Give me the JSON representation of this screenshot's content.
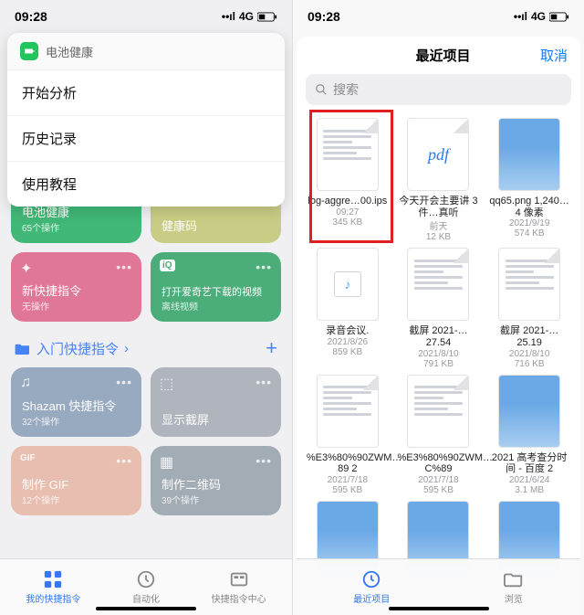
{
  "left": {
    "status": {
      "time": "09:28",
      "net": "4G"
    },
    "sheet": {
      "app": "电池健康",
      "items": [
        "开始分析",
        "历史记录",
        "使用教程"
      ]
    },
    "cards": [
      {
        "title": "电池健康",
        "sub": "65个操作",
        "color": "#2fb26a"
      },
      {
        "title": "健康码",
        "sub": "",
        "color": "#c4c979"
      },
      {
        "title": "新快捷指令",
        "sub": "无操作",
        "color": "#e06a8e"
      },
      {
        "title": "打开爱奇艺下载的视频",
        "sub": "离线视频",
        "color": "#3aa66d"
      }
    ],
    "section": {
      "label": "入门快捷指令",
      "plus": "+"
    },
    "starter": [
      {
        "title": "Shazam 快捷指令",
        "sub": "32个操作",
        "color": "#8fa3bb"
      },
      {
        "title": "显示截屏",
        "sub": "",
        "color": "#a8aeb8"
      },
      {
        "title": "制作 GIF",
        "sub": "12个操作",
        "color": "#e7b9a8"
      },
      {
        "title": "制作二维码",
        "sub": "39个操作",
        "color": "#9aa5ae"
      }
    ],
    "tabs": [
      "我的快捷指令",
      "自动化",
      "快捷指令中心"
    ]
  },
  "right": {
    "status": {
      "time": "09:28",
      "net": "4G"
    },
    "header": {
      "title": "最近项目",
      "cancel": "取消"
    },
    "search_placeholder": "搜索",
    "files": [
      {
        "name": "log-aggre…00.ips",
        "date": "09:27",
        "size": "345 KB",
        "type": "doc"
      },
      {
        "name": "今天开会主要讲 3 件…真听",
        "date": "前天",
        "size": "12 KB",
        "type": "pdf"
      },
      {
        "name": "qq65.png 1,240…4 像素",
        "date": "2021/9/19",
        "size": "574 KB",
        "type": "img"
      },
      {
        "name": "录音会议.",
        "date": "2021/8/26",
        "size": "859 KB",
        "type": "audio"
      },
      {
        "name": "截屏 2021-…27.54",
        "date": "2021/8/10",
        "size": "791 KB",
        "type": "doc"
      },
      {
        "name": "截屏 2021-…25.19",
        "date": "2021/8/10",
        "size": "716 KB",
        "type": "doc"
      },
      {
        "name": "%E3%80%90ZWM…89 2",
        "date": "2021/7/18",
        "size": "595 KB",
        "type": "doc"
      },
      {
        "name": "%E3%80%90ZWM…C%89",
        "date": "2021/7/18",
        "size": "595 KB",
        "type": "doc"
      },
      {
        "name": "2021 高考查分时间 - 百度 2",
        "date": "2021/6/24",
        "size": "3.1 MB",
        "type": "img2"
      },
      {
        "name": "",
        "date": "",
        "size": "",
        "type": "img"
      },
      {
        "name": "",
        "date": "",
        "size": "",
        "type": "img"
      },
      {
        "name": "",
        "date": "",
        "size": "",
        "type": "img"
      }
    ],
    "tabs": [
      "最近项目",
      "浏览"
    ]
  }
}
